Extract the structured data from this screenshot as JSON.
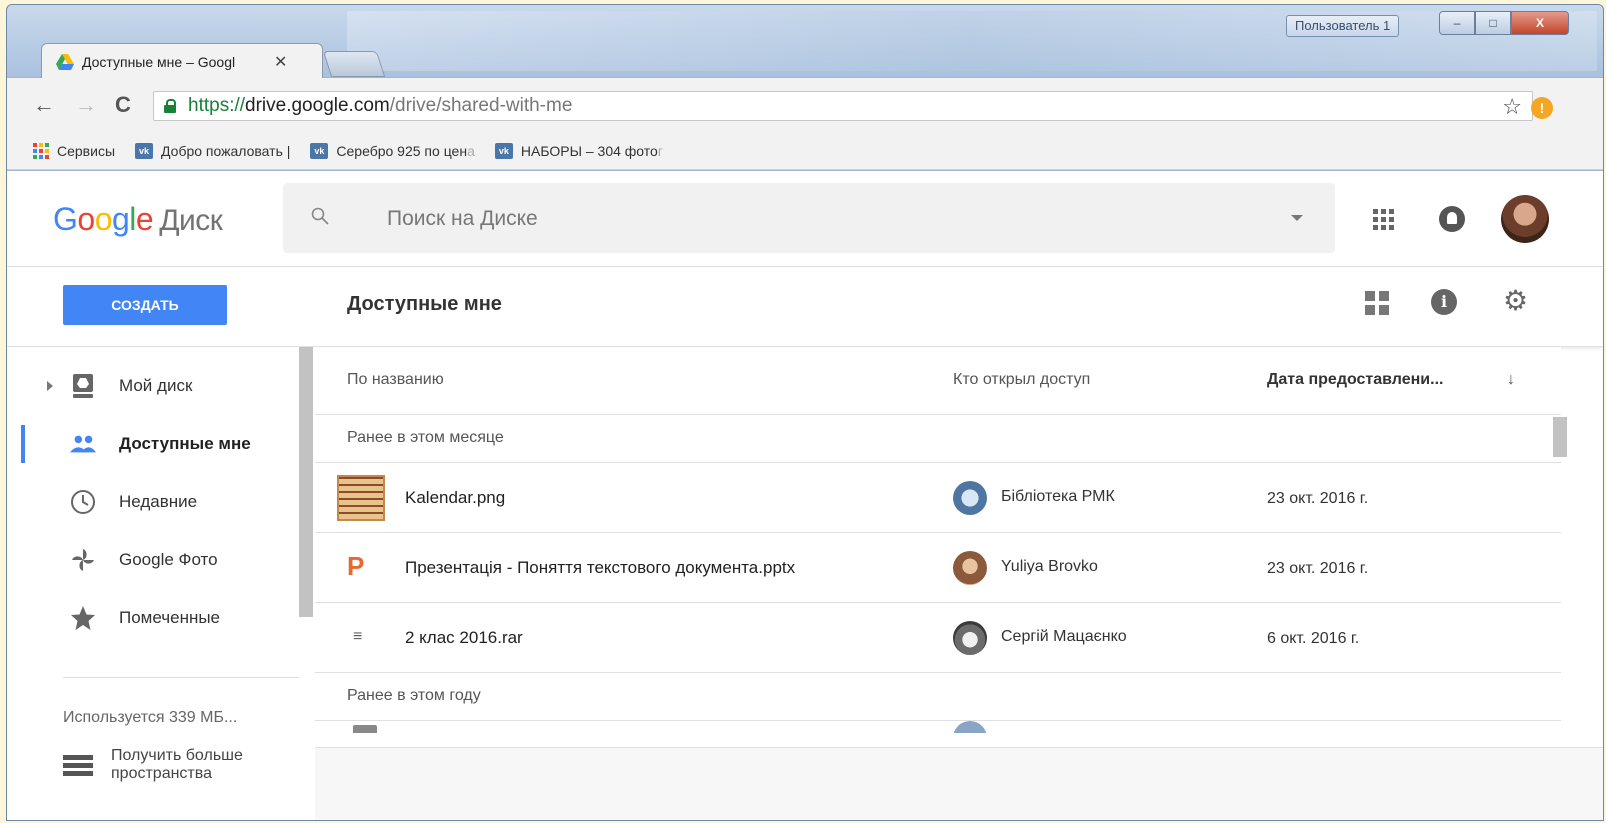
{
  "browser": {
    "tab_title": "Доступные мне – Googl",
    "tab_close": "✕",
    "user_badge": "Пользователь 1",
    "url_scheme": "https://",
    "url_host": "drive.google.com",
    "url_path": "/drive/shared-with-me",
    "back": "←",
    "forward": "→",
    "reload": "C",
    "star": "☆",
    "ext_badge": "!",
    "window_minimize": "–",
    "window_maximize": "□",
    "window_close": "X"
  },
  "bookmarks": [
    {
      "label": "Сервисы",
      "icon": "apps-grid-icon"
    },
    {
      "label": "Добро пожаловать |",
      "icon": "vk-icon"
    },
    {
      "label": "Серебро 925 по цен",
      "fade": "а",
      "icon": "vk-icon"
    },
    {
      "label": "НАБОРЫ – 304 фото",
      "fade": "г",
      "icon": "vk-icon"
    }
  ],
  "vk_label": "vk",
  "header": {
    "logo_letters": [
      "G",
      "o",
      "o",
      "g",
      "l",
      "e"
    ],
    "product": "Диск",
    "search_placeholder": "Поиск на Диске"
  },
  "toolbar": {
    "create_label": "СОЗДАТЬ",
    "page_title": "Доступные мне",
    "info_glyph": "i",
    "gear_glyph": "⚙"
  },
  "sidebar": {
    "items": [
      {
        "label": "Мой диск",
        "icon": "drive-icon"
      },
      {
        "label": "Доступные мне",
        "icon": "people-icon"
      },
      {
        "label": "Недавние",
        "icon": "clock-icon"
      },
      {
        "label": "Google Фото",
        "icon": "pinwheel-icon"
      },
      {
        "label": "Помеченные",
        "icon": "star-icon"
      }
    ],
    "storage_text": "Используется 339 МБ...",
    "more_storage": "Получить больше пространства"
  },
  "list": {
    "columns": {
      "name": "По названию",
      "owner": "Кто открыл доступ",
      "date": "Дата предоставлени...",
      "sort_arrow": "↓"
    },
    "groups": [
      "Ранее в этом месяце",
      "Ранее в этом году"
    ],
    "rows": [
      {
        "name": "Kalendar.png",
        "owner": "Бібліотека РМК",
        "date": "23 окт. 2016 г.",
        "type": "image"
      },
      {
        "name": "Презентація - Поняття текстового документа.pptx",
        "owner": "Yuliya Brovko",
        "date": "23 окт. 2016 г.",
        "type": "presentation"
      },
      {
        "name": "2 клас 2016.rar",
        "owner": "Сергій Мацаєнко",
        "date": "6 окт. 2016 г.",
        "type": "archive"
      }
    ],
    "ppt_glyph": "P",
    "rar_glyph": "≡"
  },
  "colors": {
    "accent": "#4285f4",
    "ppt": "#e8692f",
    "vk": "#4a76a8",
    "lock": "#188038"
  }
}
